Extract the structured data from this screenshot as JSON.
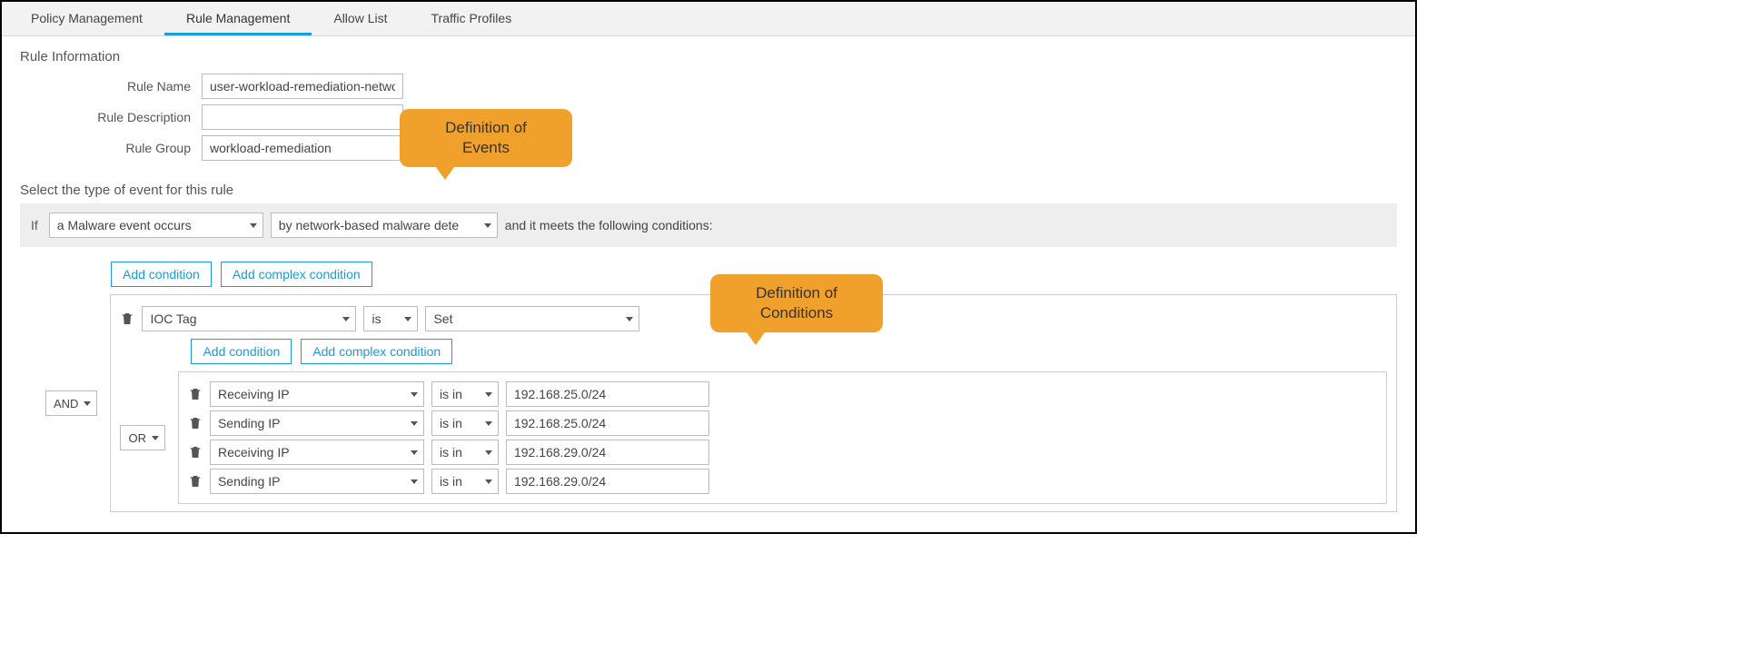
{
  "tabs": [
    "Policy Management",
    "Rule Management",
    "Allow List",
    "Traffic Profiles"
  ],
  "section_title": "Rule Information",
  "labels": {
    "name": "Rule Name",
    "desc": "Rule Description",
    "group": "Rule Group"
  },
  "values": {
    "name": "user-workload-remediation-netwo",
    "desc": "",
    "group": "workload-remediation"
  },
  "subtitle": "Select the type of event for this rule",
  "if_label": "If",
  "event_type": "a Malware event occurs",
  "event_sub": "by network-based malware dete",
  "post_text": "and it meets the following conditions:",
  "btn_add": "Add condition",
  "btn_addc": "Add complex condition",
  "op_and": "AND",
  "op_or": "OR",
  "top_cond": {
    "field": "IOC Tag",
    "op": "is",
    "val": "Set"
  },
  "rows": [
    {
      "field": "Receiving IP",
      "op": "is in",
      "val": "192.168.25.0/24"
    },
    {
      "field": "Sending IP",
      "op": "is in",
      "val": "192.168.25.0/24"
    },
    {
      "field": "Receiving IP",
      "op": "is in",
      "val": "192.168.29.0/24"
    },
    {
      "field": "Sending IP",
      "op": "is in",
      "val": "192.168.29.0/24"
    }
  ],
  "callout1_l1": "Definition of",
  "callout1_l2": "Events",
  "callout2_l1": "Definition of",
  "callout2_l2": "Conditions"
}
